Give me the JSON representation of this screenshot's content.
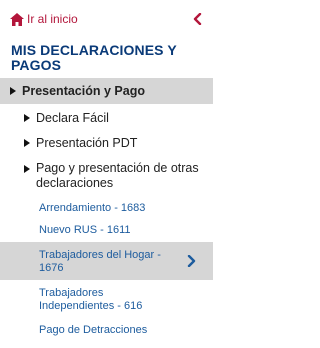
{
  "nav": {
    "home_label": "Ir al inicio",
    "section_title": "MIS DECLARACIONES Y PAGOS",
    "level1": {
      "label": "Presentación y Pago"
    },
    "level2": [
      {
        "label": "Declara Fácil"
      },
      {
        "label": "Presentación PDT"
      },
      {
        "label": "Pago y presentación de otras declaraciones"
      }
    ],
    "leaves": [
      {
        "label": "Arrendamiento - 1683"
      },
      {
        "label": "Nuevo RUS - 1611"
      },
      {
        "label": "Trabajadores del Hogar - 1676",
        "selected": true
      },
      {
        "label": "Trabajadores Independientes - 616"
      },
      {
        "label": "Pago de Detracciones"
      }
    ]
  },
  "colors": {
    "accent_red": "#b3163b",
    "title_blue": "#0a3a78",
    "link_blue": "#1d5c9e",
    "highlight_gray": "#d6d6d6"
  }
}
